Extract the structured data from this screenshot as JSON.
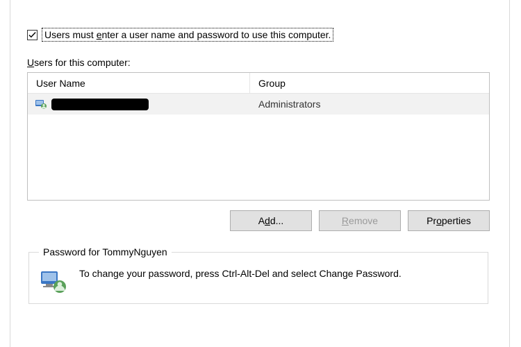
{
  "checkbox": {
    "checked": true,
    "label_pre": "Users must ",
    "label_accel": "e",
    "label_post": "nter a user name and password to use this computer."
  },
  "users_label_pre": "",
  "users_label_accel": "U",
  "users_label_post": "sers for this computer:",
  "columns": {
    "name": "User Name",
    "group": "Group"
  },
  "rows": [
    {
      "name_redacted": true,
      "group": "Administrators"
    }
  ],
  "buttons": {
    "add_pre": "A",
    "add_accel": "d",
    "add_post": "d...",
    "remove_accel": "R",
    "remove_post": "emove",
    "properties_pre": "Pr",
    "properties_accel": "o",
    "properties_post": "perties",
    "remove_disabled": true
  },
  "password_group": {
    "legend": "Password for TommyNguyen",
    "text": "To change your password, press Ctrl-Alt-Del and select Change Password."
  }
}
